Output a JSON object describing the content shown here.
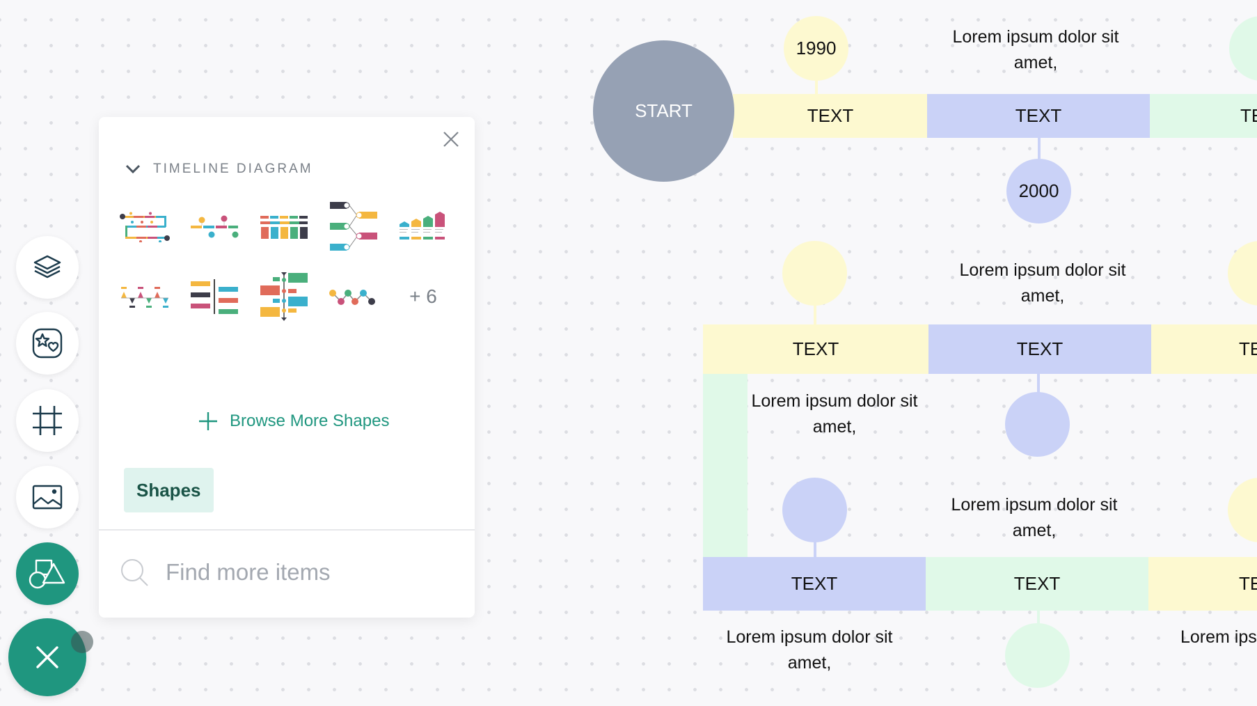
{
  "toolbar": {
    "buttons": [
      {
        "name": "layers",
        "icon": "layers-icon"
      },
      {
        "name": "favorites",
        "icon": "star-heart-icon"
      },
      {
        "name": "frame",
        "icon": "frame-icon"
      },
      {
        "name": "image",
        "icon": "image-icon"
      },
      {
        "name": "shapes",
        "icon": "shapes-icon",
        "active": true
      }
    ],
    "fab_icon": "close-icon"
  },
  "panel": {
    "section_title": "TIMELINE DIAGRAM",
    "templates_count": 9,
    "more_label": "+ 6",
    "browse_label": "Browse More Shapes",
    "chip_label": "Shapes",
    "search_placeholder": "Find more items",
    "search_value": ""
  },
  "diagram": {
    "start_label": "START",
    "row1": {
      "bars": [
        {
          "label": "TEXT",
          "color": "yellow"
        },
        {
          "label": "TEXT",
          "color": "blue"
        },
        {
          "label": "TE",
          "color": "green"
        }
      ],
      "year1": "1990",
      "year2": "2000",
      "lorem": "Lorem ipsum dolor sit amet,"
    },
    "row2": {
      "bars": [
        {
          "label": "TEXT",
          "color": "yellow"
        },
        {
          "label": "TEXT",
          "color": "blue"
        },
        {
          "label": "TE",
          "color": "yellow"
        }
      ],
      "lorem_top": "Lorem ipsum dolor sit amet,",
      "lorem_bottom": "Lorem ipsum dolor sit amet,"
    },
    "row3": {
      "bars": [
        {
          "label": "TEXT",
          "color": "blue"
        },
        {
          "label": "TEXT",
          "color": "green"
        },
        {
          "label": "TE",
          "color": "yellow"
        }
      ],
      "lorem_top": "Lorem ipsum dolor sit amet,",
      "lorem_bottom_left": "Lorem ipsum dolor sit amet,",
      "lorem_bottom_right": "Lorem ips a"
    }
  },
  "colors": {
    "accent": "#1f967f",
    "yellow": "#fdf9d0",
    "blue": "#cad2f7",
    "green": "#e0f9e8",
    "start": "#96a1b4"
  }
}
